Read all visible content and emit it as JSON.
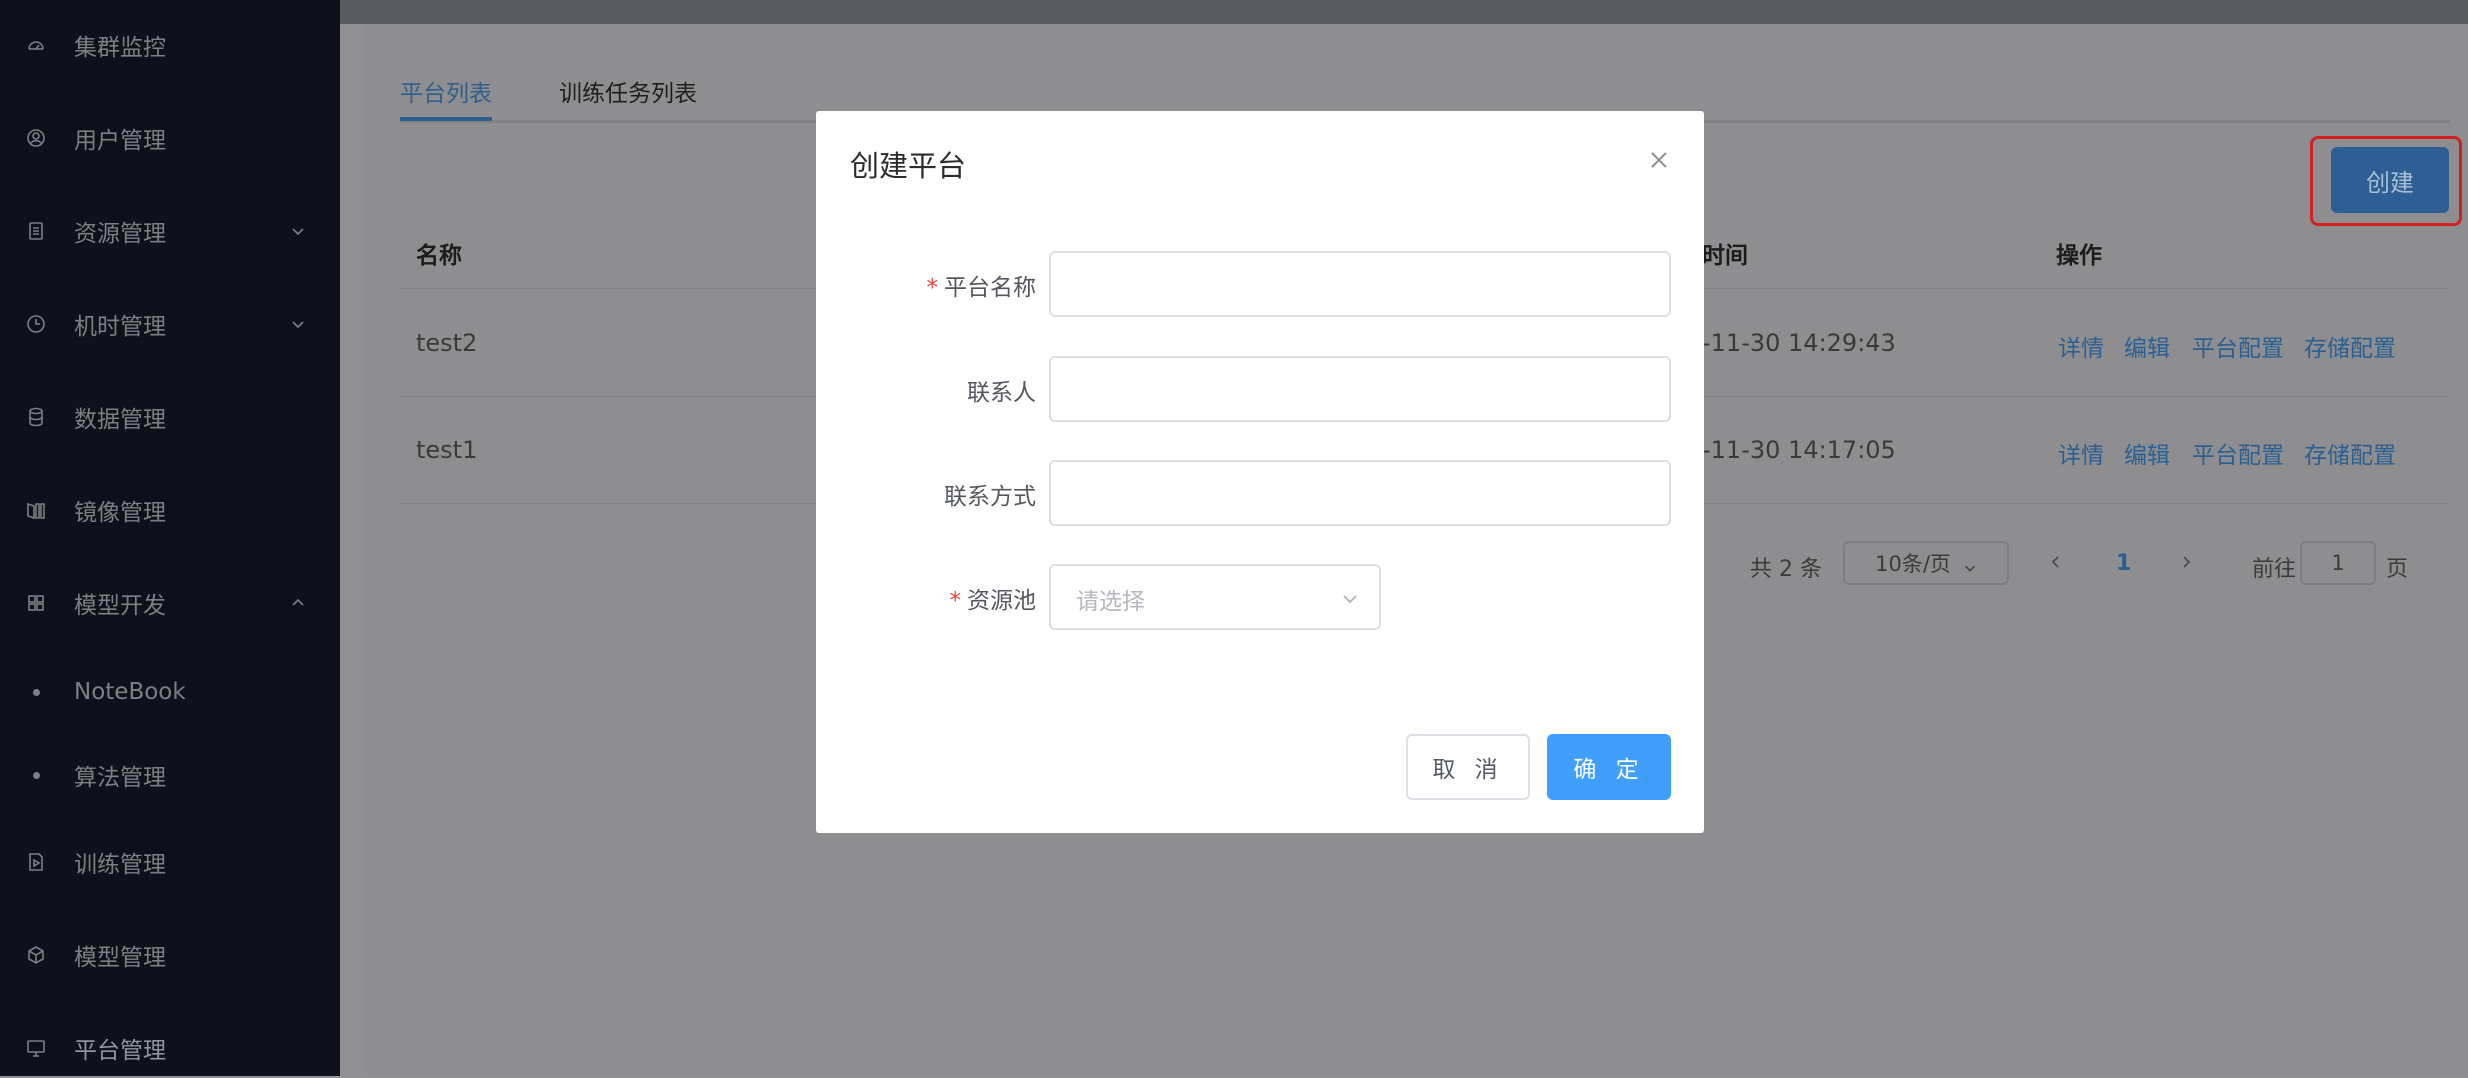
{
  "sidebar": {
    "items": [
      {
        "label": "集群监控",
        "icon": "dashboard-icon"
      },
      {
        "label": "用户管理",
        "icon": "user-circle-icon"
      },
      {
        "label": "资源管理",
        "icon": "document-icon"
      },
      {
        "label": "机时管理",
        "icon": "clock-icon"
      },
      {
        "label": "数据管理",
        "icon": "database-icon"
      },
      {
        "label": "镜像管理",
        "icon": "book-icon"
      },
      {
        "label": "模型开发",
        "icon": "grid-icon"
      },
      {
        "label": "NoteBook",
        "icon": "dot"
      },
      {
        "label": "算法管理",
        "icon": "dot"
      },
      {
        "label": "训练管理",
        "icon": "file-play-icon"
      },
      {
        "label": "模型管理",
        "icon": "cube-icon"
      },
      {
        "label": "平台管理",
        "icon": "monitor-icon"
      }
    ]
  },
  "main": {
    "tabs": [
      {
        "label": "平台列表",
        "active": true
      },
      {
        "label": "训练任务列表",
        "active": false
      }
    ],
    "create_button": "创建",
    "table": {
      "headers": [
        "名称",
        "时间",
        "操作"
      ],
      "rows": [
        {
          "name": "test2",
          "time": "-11-30 14:29:43"
        },
        {
          "name": "test1",
          "time": "-11-30 14:17:05"
        }
      ],
      "actions": [
        "详情",
        "编辑",
        "平台配置",
        "存储配置"
      ]
    },
    "pagination": {
      "total": "共 2 条",
      "page_size": "10条/页",
      "current_page": "1",
      "goto_label": "前往",
      "goto_value": "1",
      "page_suffix": "页"
    }
  },
  "dialog": {
    "title": "创建平台",
    "fields": [
      {
        "label": "平台名称",
        "required": true,
        "value": ""
      },
      {
        "label": "联系人",
        "required": false,
        "value": ""
      },
      {
        "label": "联系方式",
        "required": false,
        "value": ""
      },
      {
        "label": "资源池",
        "required": true,
        "placeholder": "请选择"
      }
    ],
    "required_mark": "*",
    "cancel_label": "取 消",
    "ok_label": "确 定"
  },
  "colors": {
    "primary": "#409eff",
    "sidebar_bg": "#0f111a",
    "required": "#f0443a",
    "highlight_outline": "#d32020"
  }
}
